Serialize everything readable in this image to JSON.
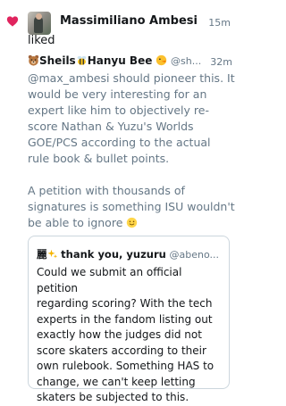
{
  "notification": {
    "icon": "heart-icon",
    "accent": "#e0245e",
    "actor_name": "Massimiliano Ambesi",
    "action": "liked",
    "time": "15m"
  },
  "tweet": {
    "author_name": "Sheils",
    "author_name_2": "Hanyu Bee",
    "author_emojis": [
      "bear-icon",
      "bee-icon",
      "duck-icon"
    ],
    "handle": "@sh...",
    "time": "32m",
    "text": "@max_ambesi should pioneer this. It\nwould be very interesting for an\nexpert like him to objectively re-\nscore Nathan & Yuzu's Worlds\nGOE/PCS according to the actual\nrule book & bullet points.\n\nA petition with thousands of\nsignatures is something ISU wouldn't\nbe able to ignore",
    "text_emoji": "smiley-icon"
  },
  "quoted": {
    "author_prefix": "麗",
    "author_name": "thank you, yuzuru",
    "author_emoji": "sparkles-icon",
    "handle": "@abeno...",
    "text": "Could we submit an official petition\nregarding scoring? With the tech\nexperts in the fandom listing out\nexactly how the judges did not\nscore skaters according to their\nown rulebook. Something HAS to\nchange, we can't keep letting\nskaters be subjected to this."
  }
}
